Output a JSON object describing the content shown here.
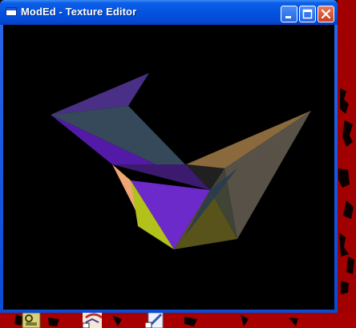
{
  "window": {
    "title": "ModEd - Texture Editor",
    "icon": "app-window-icon"
  },
  "controls": {
    "minimize_icon": "minimize-icon",
    "maximize_icon": "maximize-icon",
    "close_icon": "close-icon"
  },
  "viewport": {
    "background": "#000000",
    "model": "3d-polygon-mesh"
  },
  "colors": {
    "titlebar": "#0353e0",
    "close_button": "#c83f1c",
    "desktop_red": "#c20000"
  },
  "desktop_icons": [
    {
      "icon": "shortcut-icon-1"
    },
    {
      "icon": "shortcut-icon-2"
    },
    {
      "icon": "shortcut-icon-3"
    }
  ]
}
